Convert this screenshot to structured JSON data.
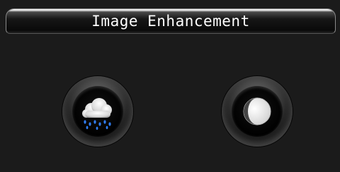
{
  "header": {
    "title": "Image Enhancement"
  },
  "menu": {
    "items": [
      {
        "icon": "rain-cloud-icon"
      },
      {
        "icon": "contrast-icon"
      }
    ]
  },
  "colors": {
    "background": "#1b1b1b",
    "title_text": "#ffffff",
    "raindrop": "#2f7df2"
  }
}
